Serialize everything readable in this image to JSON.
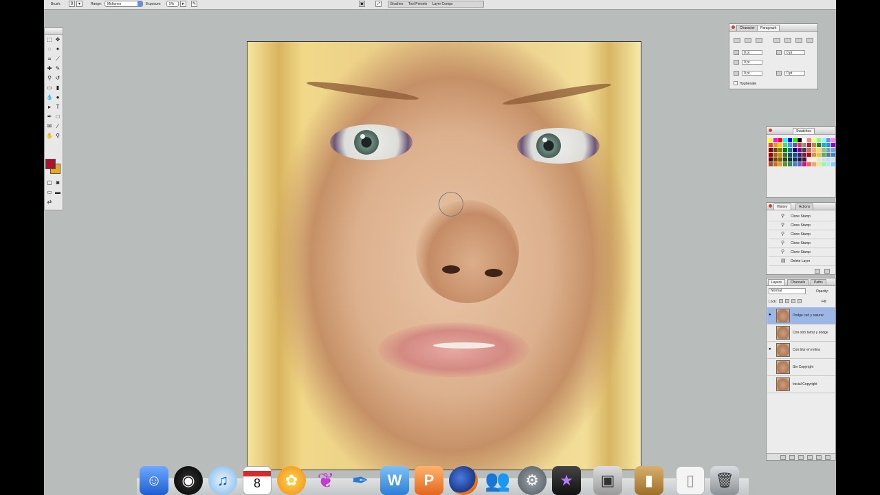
{
  "options_bar": {
    "brush_label": "Brush:",
    "brush_size": "9",
    "range_label": "Range:",
    "range_value": "Midtones",
    "exposure_label": "Exposure:",
    "exposure_value": "5%",
    "tabs": [
      "Brushes",
      "Tool Presets",
      "Layer Comps"
    ]
  },
  "paragraph_palette": {
    "tabs": [
      "Character",
      "Paragraph"
    ],
    "fields": [
      "0 pt",
      "0 pt",
      "0 pt",
      "0 pt",
      "0 pt"
    ],
    "hyphenate_label": "Hyphenate"
  },
  "swatches_palette": {
    "tabs": [
      "Swatches"
    ],
    "colors": [
      "#ffff00",
      "#ff00ff",
      "#ff0000",
      "#00ffff",
      "#0000ff",
      "#00ff00",
      "#000000",
      "#ffffff",
      "#ff8080",
      "#ffff80",
      "#80ff80",
      "#80ffff",
      "#8080ff",
      "#ff80ff",
      "#c0c0c0",
      "#ff3b30",
      "#ff9500",
      "#ffcc00",
      "#4cd964",
      "#34aadc",
      "#5856d6",
      "#ff2d55",
      "#8e8e93",
      "#b22222",
      "#cd853f",
      "#228b22",
      "#20b2aa",
      "#1e90ff",
      "#9400d3",
      "#808080",
      "#800000",
      "#804000",
      "#808000",
      "#008000",
      "#008080",
      "#000080",
      "#800080",
      "#404040",
      "#e06666",
      "#f6b26b",
      "#ffd966",
      "#93c47d",
      "#76a5af",
      "#6fa8dc",
      "#8e7cc3",
      "#990000",
      "#b45f06",
      "#bf9000",
      "#38761d",
      "#134f5c",
      "#0b5394",
      "#351c75",
      "#741b47",
      "#cc0000",
      "#e69138",
      "#f1c232",
      "#6aa84f",
      "#45818e",
      "#3d85c6",
      "#674ea7",
      "#660000",
      "#783f04",
      "#7f6000",
      "#274e13",
      "#0c343d",
      "#073763",
      "#20124d",
      "#4c1130",
      "#ffe5e5",
      "#fff2cc",
      "#d9ead3",
      "#d0e0e3",
      "#c9daf8",
      "#cfe2f3",
      "#d9d2e9",
      "#a0522d",
      "#d2691e",
      "#daa520",
      "#6b8e23",
      "#2e8b57",
      "#4682b4",
      "#6a5acd",
      "#c71585",
      "#ff6347",
      "#ffa07a",
      "#f0e68c",
      "#98fb98",
      "#afeeee",
      "#87cefa",
      "#dda0dd"
    ]
  },
  "history_palette": {
    "tabs": [
      "History",
      "Actions"
    ],
    "items": [
      "Clone Stamp",
      "Clone Stamp",
      "Clone Stamp",
      "Clone Stamp",
      "Clone Stamp",
      "Delete Layer"
    ]
  },
  "layers_palette": {
    "tabs": [
      "Layers",
      "Channels",
      "Paths"
    ],
    "blend_mode": "Normal",
    "opacity_label": "Opacity:",
    "lock_label": "Lock:",
    "fill_label": "Fill:",
    "layers": [
      {
        "name": "Dodge curl y saturar",
        "selected": true,
        "visible": true
      },
      {
        "name": "Con otro tamiz y dodge",
        "selected": false,
        "visible": false
      },
      {
        "name": "Con blur en retina",
        "selected": false,
        "visible": true
      },
      {
        "name": "Sin Copyright",
        "selected": false,
        "visible": false
      },
      {
        "name": "Inicial Copyright",
        "selected": false,
        "visible": false
      }
    ]
  },
  "calendar": {
    "day": "8"
  },
  "dock_icons": [
    "finder-icon",
    "dashboard-icon",
    "itunes-icon",
    "ical-icon",
    "iphoto-flower-icon",
    "butterfly-icon",
    "feather-icon",
    "word-icon",
    "powerpoint-icon",
    "firefox-icon",
    "messenger-icon",
    "system-preferences-icon",
    "imovie-icon",
    "screenshot-icon",
    "book-icon",
    "document-icon",
    "trash-icon"
  ]
}
